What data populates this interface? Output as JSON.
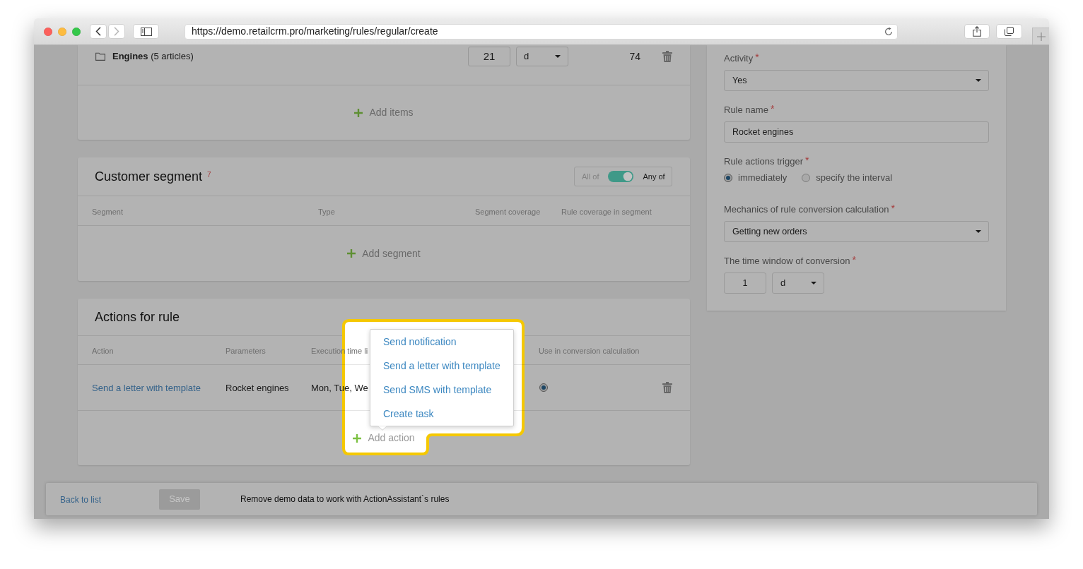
{
  "browser": {
    "url": "https://demo.retailcrm.pro/marketing/rules/regular/create",
    "forward_disabled": true
  },
  "products_card": {
    "items": [
      {
        "name": "**Engines** (5 articles)",
        "quantity": "21",
        "unit": "d",
        "count": "74"
      }
    ],
    "add_label": "Add items"
  },
  "segment_card": {
    "title": "Customer segment $^{7}$",
    "match_switch": {
      "left_label": "All of",
      "right_label": "Any of",
      "on": true
    },
    "columns": [
      "Segment",
      "Type",
      "Segment coverage",
      "Rule coverage in segment"
    ],
    "add_label": "Add segment"
  },
  "actions_card": {
    "title": "Actions for rule",
    "columns": [
      "Action",
      "Parameters",
      "Execution time li",
      "Use in conversion calculation"
    ],
    "rows": [
      {
        "action": "Send a letter with template",
        "parameters": "Rocket engines",
        "execution_time": "Mon, Tue, We",
        "use_in_conversion": true
      }
    ],
    "add_label": "Add action",
    "add_menu_expanded": true,
    "add_menu": [
      "Send notification",
      "Send a letter with template",
      "Send SMS with template",
      "Create task"
    ]
  },
  "settings_panel": {
    "fields": [
      {
        "kind": "select",
        "label": "Activity",
        "required_mark": "*",
        "value": "Yes"
      },
      {
        "kind": "input",
        "label": "Rule name",
        "required_mark": "*",
        "value": "Rocket engines"
      },
      {
        "kind": "radio",
        "label": "Rule actions trigger",
        "required_mark": "*",
        "options": [
          {
            "label": "immediately",
            "selected": true
          },
          {
            "label": "specify the interval",
            "selected": false
          }
        ]
      },
      {
        "kind": "select",
        "label": "Mechanics of rule conversion calculation",
        "required_mark": "*",
        "value": "Getting new orders"
      },
      {
        "kind": "duration",
        "label": "The time window of conversion",
        "required_mark": "*",
        "value": "1",
        "unit": "d"
      }
    ]
  },
  "footer": {
    "back_link": "Back to list",
    "save_button": {
      "label": "Save",
      "disabled": true
    },
    "notice": "Remove demo data to work with ActionAssistant`s rules"
  }
}
